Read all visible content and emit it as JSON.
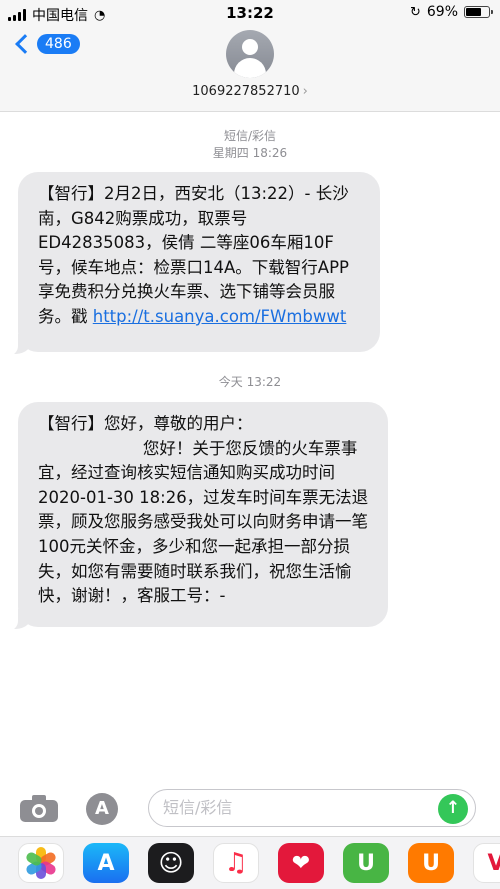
{
  "status_bar": {
    "carrier": "中国电信",
    "time": "13:22",
    "battery": "69%",
    "battery_level": 0.69
  },
  "nav": {
    "back_count": "486",
    "contact_number": "1069227852710",
    "chevron": "›"
  },
  "conversation": {
    "thread_type": "短信/彩信",
    "first_timestamp": "星期四 18:26",
    "second_timestamp": "今天 13:22",
    "messages": [
      {
        "text": "【智行】2月2日，西安北（13:22）- 长沙南，G842购票成功，取票号ED42835083，侯倩 二等座06车厢10F号，候车地点：检票口14A。下载智行APP享免费积分兑换火车票、选下铺等会员服务。戳 ",
        "link": "http://t.suanya.com/FWmbwwt"
      },
      {
        "text": "【智行】您好，尊敬的用户：\n                    您好！关于您反馈的火车票事宜，经过查询核实短信通知购买成功时间2020-01-30 18:26，过发车时间车票无法退票，顾及您服务感受我处可以向财务申请一笔100元关怀金，多少和您一起承担一部分损失，如您有需要随时联系我们，祝您生活愉快，谢谢！，客服工号：-"
      }
    ]
  },
  "input": {
    "placeholder": "短信/彩信",
    "appstore_glyph": "A",
    "send_glyph": "↑"
  },
  "drawer": {
    "apps": [
      {
        "name": "photos-icon"
      },
      {
        "name": "appstore-icon",
        "glyph": "A"
      },
      {
        "name": "memoji-icon",
        "glyph": "☺"
      },
      {
        "name": "music-icon",
        "glyph": "♫"
      },
      {
        "name": "heart-app-icon",
        "glyph": "❤"
      },
      {
        "name": "green-app-icon",
        "glyph": "U"
      },
      {
        "name": "uc-browser-icon",
        "glyph": "U"
      },
      {
        "name": "partial-app-icon",
        "glyph": "V"
      }
    ]
  },
  "colors": {
    "accent_blue": "#1a7cf5",
    "bubble_gray": "#e9e9eb",
    "send_green": "#34c759"
  }
}
